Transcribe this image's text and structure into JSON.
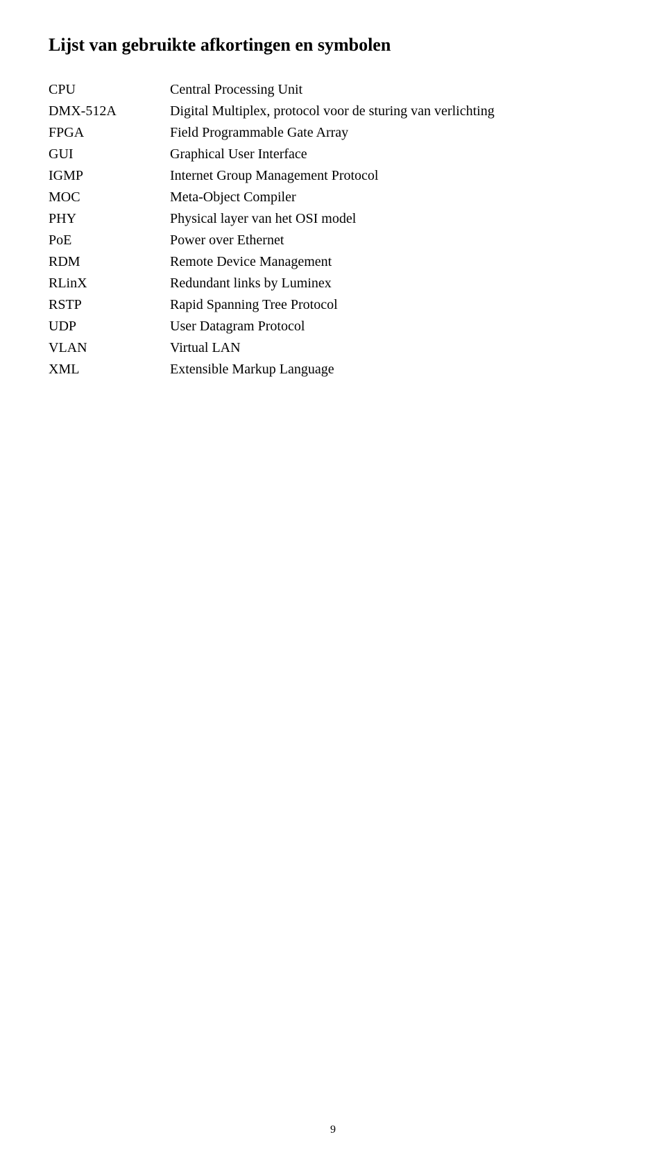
{
  "heading": "Lijst van gebruikte afkortingen en symbolen",
  "rows": [
    {
      "abbr": "CPU",
      "desc": "Central Processing Unit"
    },
    {
      "abbr": "DMX-512A",
      "desc": "Digital Multiplex, protocol voor de sturing van verlichting"
    },
    {
      "abbr": "FPGA",
      "desc": "Field Programmable Gate Array"
    },
    {
      "abbr": "GUI",
      "desc": "Graphical User Interface"
    },
    {
      "abbr": "IGMP",
      "desc": "Internet Group Management Protocol"
    },
    {
      "abbr": "MOC",
      "desc": "Meta-Object Compiler"
    },
    {
      "abbr": "PHY",
      "desc": "Physical layer van het OSI model"
    },
    {
      "abbr": "PoE",
      "desc": "Power over Ethernet"
    },
    {
      "abbr": "RDM",
      "desc": "Remote Device Management"
    },
    {
      "abbr": "RLinX",
      "desc": "Redundant links by Luminex"
    },
    {
      "abbr": "RSTP",
      "desc": "Rapid Spanning Tree Protocol"
    },
    {
      "abbr": "UDP",
      "desc": "User Datagram Protocol"
    },
    {
      "abbr": "VLAN",
      "desc": "Virtual LAN"
    },
    {
      "abbr": "XML",
      "desc": "Extensible Markup Language"
    }
  ],
  "pageNumber": "9"
}
